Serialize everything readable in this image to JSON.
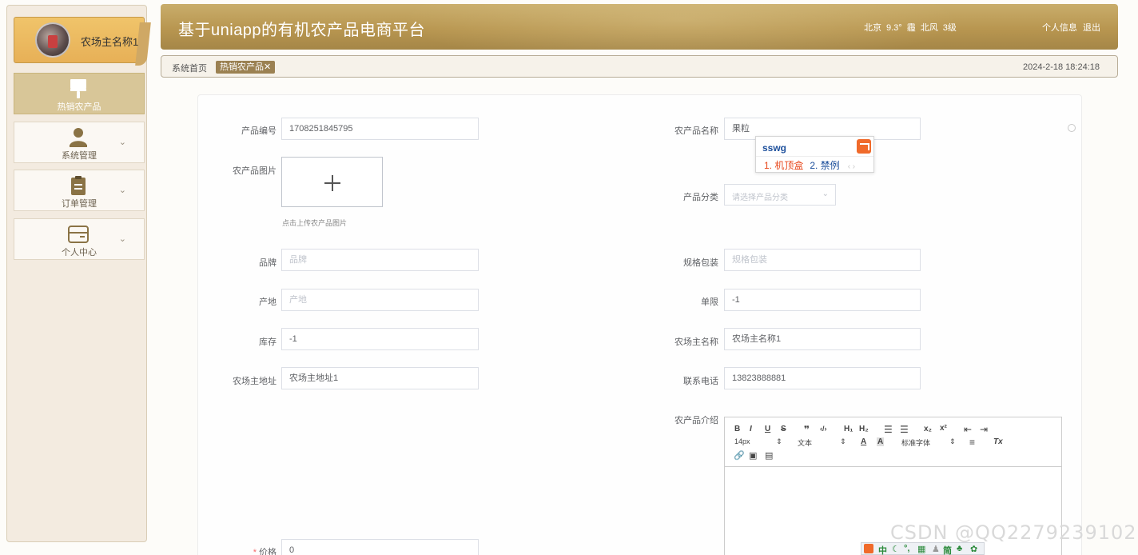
{
  "sidebar": {
    "username": "农场主名称1",
    "menu": [
      {
        "label": "热销农产品",
        "icon": "brush-icon",
        "active": true
      },
      {
        "label": "系统管理",
        "icon": "person-icon",
        "active": false
      },
      {
        "label": "订单管理",
        "icon": "clipboard-icon",
        "active": false
      },
      {
        "label": "个人中心",
        "icon": "card-icon",
        "active": false
      }
    ]
  },
  "header": {
    "title": "基于uniapp的有机农产品电商平台",
    "weather": {
      "city": "北京",
      "temp": "9.3°",
      "condition": "霾",
      "wind": "北风",
      "level": "3级"
    },
    "profile_link": "个人信息",
    "logout_link": "退出"
  },
  "breadcrumb": {
    "home": "系统首页",
    "tag": "热销农产品",
    "tag_close": "✕",
    "datetime": "2024-2-18 18:24:18"
  },
  "form": {
    "product_code": {
      "label": "产品编号",
      "value": "1708251845795"
    },
    "product_name": {
      "label": "农产品名称",
      "value": "果粒"
    },
    "image": {
      "label": "农产品图片",
      "tip": "点击上传农产品图片"
    },
    "category": {
      "label": "产品分类",
      "placeholder": "请选择产品分类"
    },
    "brand": {
      "label": "品牌",
      "placeholder": "品牌"
    },
    "spec": {
      "label": "规格包装",
      "placeholder": "规格包装"
    },
    "origin": {
      "label": "产地",
      "placeholder": "产地"
    },
    "limit": {
      "label": "单限",
      "value": "-1"
    },
    "stock": {
      "label": "库存",
      "value": "-1"
    },
    "farmer_name": {
      "label": "农场主名称",
      "value": "农场主名称1"
    },
    "farmer_address": {
      "label": "农场主地址",
      "value": "农场主地址1"
    },
    "phone": {
      "label": "联系电话",
      "value": "13823888881"
    },
    "intro": {
      "label": "农产品介绍"
    },
    "price": {
      "label": "价格",
      "value": "0",
      "required_mark": "*"
    }
  },
  "ime": {
    "composition": "sswg",
    "candidates": [
      "1. 机顶盒",
      "2. 禁例"
    ],
    "nav": "‹ ›"
  },
  "editor": {
    "font_size": "14px",
    "text_type": "文本",
    "font_family": "标准字体"
  },
  "watermark": "CSDN @QQ2279239102",
  "taskbar": {
    "lang": "中",
    "simplified": "简"
  }
}
